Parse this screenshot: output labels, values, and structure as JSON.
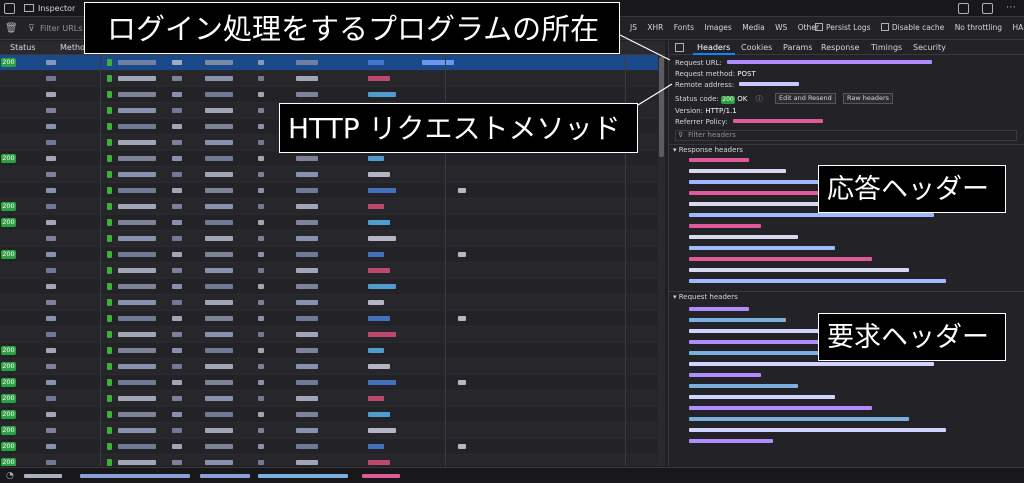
{
  "toolbar": {
    "inspector_label": "Inspector",
    "filter_placeholder": "Filter URLs",
    "type_filters": [
      "JS",
      "XHR",
      "Fonts",
      "Images",
      "Media",
      "WS",
      "Other"
    ],
    "persist_logs": "Persist Logs",
    "disable_cache": "Disable cache",
    "throttling": "No throttling",
    "har": "HAR"
  },
  "list": {
    "columns": [
      "Status",
      "Method"
    ],
    "rows": [
      {
        "status": "200",
        "selected": true
      },
      {
        "status": ""
      },
      {
        "status": ""
      },
      {
        "status": ""
      },
      {
        "status": ""
      },
      {
        "status": ""
      },
      {
        "status": "200"
      },
      {
        "status": ""
      },
      {
        "status": ""
      },
      {
        "status": "200"
      },
      {
        "status": "200"
      },
      {
        "status": ""
      },
      {
        "status": "200"
      },
      {
        "status": ""
      },
      {
        "status": ""
      },
      {
        "status": ""
      },
      {
        "status": ""
      },
      {
        "status": ""
      },
      {
        "status": "200"
      },
      {
        "status": "200"
      },
      {
        "status": "200"
      },
      {
        "status": "200"
      },
      {
        "status": "200"
      },
      {
        "status": "200"
      },
      {
        "status": "200"
      },
      {
        "status": "200"
      }
    ]
  },
  "panel": {
    "tabs": [
      "Headers",
      "Cookies",
      "Params",
      "Response",
      "Timings",
      "Security"
    ],
    "request_url_label": "Request URL:",
    "request_method_label": "Request method:",
    "request_method_value": "POST",
    "remote_address_label": "Remote address:",
    "status_code_label": "Status code:",
    "status_code_value": "200",
    "status_text": "OK",
    "edit_resend": "Edit and Resend",
    "raw_headers": "Raw headers",
    "version_label": "Version:",
    "version_value": "HTTP/1.1",
    "referrer_label": "Referrer Policy:",
    "filter_headers_placeholder": "Filter headers",
    "response_headers_title": "Response headers",
    "request_headers_title": "Request headers"
  },
  "annotations": {
    "login_program": "ログイン処理をするプログラムの所在",
    "http_method": "HTTP リクエストメソッド",
    "response_headers": "応答ヘッダー",
    "request_headers": "要求ヘッダー"
  }
}
